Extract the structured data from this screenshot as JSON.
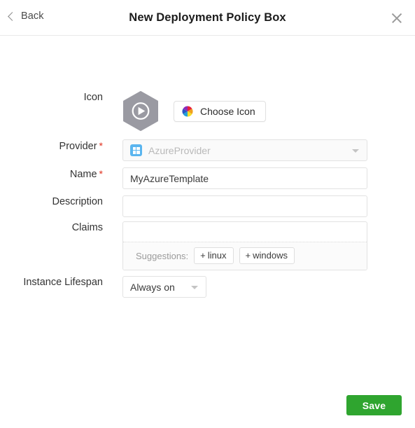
{
  "header": {
    "back_label": "Back",
    "title": "New Deployment Policy Box",
    "back_icon": "chevron-left-icon",
    "close_icon": "close-icon"
  },
  "form": {
    "icon_row": {
      "label": "Icon",
      "policy_icon": "hexagon-play-icon",
      "choose_button_label": "Choose Icon",
      "choose_button_icon": "color-wheel-icon"
    },
    "provider": {
      "label": "Provider",
      "required_mark": "*",
      "value": "AzureProvider",
      "icon": "azure-provider-icon",
      "caret_icon": "chevron-down-icon"
    },
    "name": {
      "label": "Name",
      "required_mark": "*",
      "value": "MyAzureTemplate",
      "placeholder": ""
    },
    "description": {
      "label": "Description",
      "value": "",
      "placeholder": ""
    },
    "claims": {
      "label": "Claims",
      "value": "",
      "placeholder": "",
      "suggestions_label": "Suggestions:",
      "suggestions": [
        {
          "plus": "+",
          "label": "linux"
        },
        {
          "plus": "+",
          "label": "windows"
        }
      ]
    },
    "instance_lifespan": {
      "label": "Instance Lifespan",
      "value": "Always on",
      "caret_icon": "chevron-down-icon"
    }
  },
  "footer": {
    "save_label": "Save"
  },
  "colors": {
    "save_green": "#2fa52f",
    "required_red": "#e0301e",
    "azure_blue": "#5ab5ef",
    "hexagon_gray": "#9a9aa2",
    "border_gray": "#e2e2e2"
  }
}
